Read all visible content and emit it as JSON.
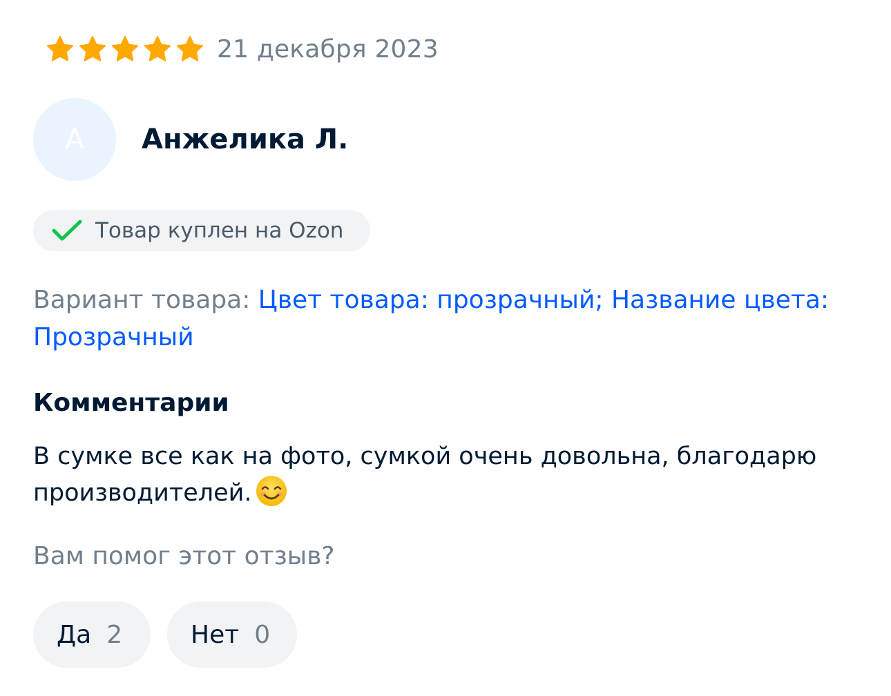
{
  "review": {
    "rating": 5,
    "max_rating": 5,
    "date": "21 декабря 2023",
    "star_color": "#ffa800",
    "author": {
      "initial": "А",
      "name": "Анжелика Л."
    },
    "purchase_badge": {
      "icon": "check-icon",
      "text": "Товар куплен на Ozon"
    },
    "variant": {
      "label": "Вариант товара:",
      "value": "Цвет товара: прозрачный; Название цвета: Прозрачный"
    },
    "comments": {
      "title": "Комментарии",
      "text": "В сумке все как на фото, сумкой очень довольна, благодарю производителей.",
      "emoji": "smiling-face-icon"
    },
    "helpful": {
      "question": "Вам помог этот отзыв?",
      "yes_label": "Да",
      "yes_count": "2",
      "no_label": "Нет",
      "no_count": "0"
    }
  }
}
